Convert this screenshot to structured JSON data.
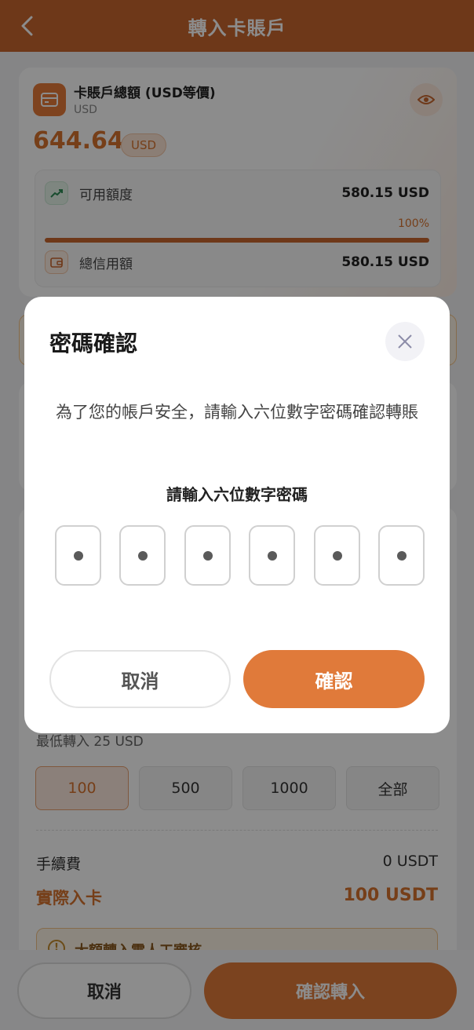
{
  "header": {
    "title": "轉入卡賬戶"
  },
  "account": {
    "title": "卡賬戶總額 (USD等價)",
    "currency": "USD",
    "balance": "644.64",
    "balance_unit": "USD"
  },
  "credit": {
    "available_label": "可用額度",
    "available_value": "580.15 USD",
    "percent_text": "100%",
    "fill_fraction": 1.0,
    "total_label": "總信用額",
    "total_value": "580.15 USD"
  },
  "amount": {
    "min_text": "最低轉入 25 USD",
    "quick_options": [
      "100",
      "500",
      "1000",
      "全部"
    ],
    "selected": "100",
    "fee_label": "手續費",
    "fee_value": "0 USDT",
    "actual_label": "實際入卡",
    "actual_value": "100 USDT",
    "tip_text": "大額轉入需人工審核"
  },
  "bottom": {
    "cancel_label": "取消",
    "confirm_label": "確認轉入"
  },
  "modal": {
    "title": "密碼確認",
    "description": "為了您的帳戶安全，請輸入六位數字密碼確認轉賬",
    "subtitle": "請輸入六位數字密碼",
    "pin_count": 6,
    "cancel_label": "取消",
    "confirm_label": "確認"
  },
  "colors": {
    "brand": "#c9662e",
    "accent": "#e07a3a",
    "overlay": "rgba(0,0,0,0.45)"
  }
}
